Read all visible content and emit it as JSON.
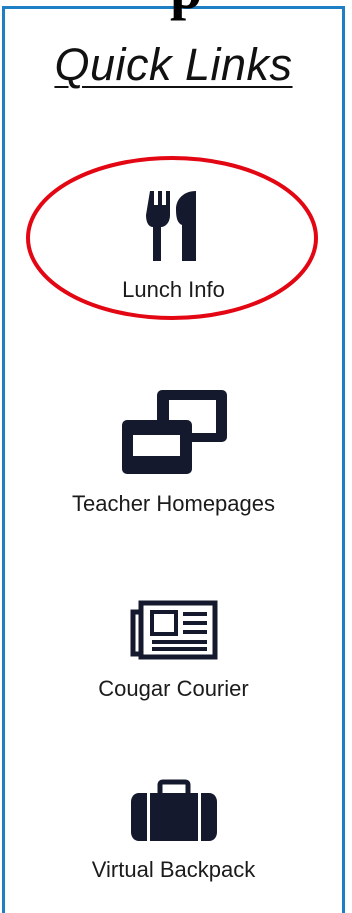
{
  "top_fragment": "p",
  "quick_links": {
    "title": "Quick Links",
    "items": [
      {
        "label": "Lunch Info",
        "icon": "utensils-icon"
      },
      {
        "label": "Teacher Homepages",
        "icon": "windows-icon"
      },
      {
        "label": "Cougar Courier",
        "icon": "newspaper-icon"
      },
      {
        "label": "Virtual Backpack",
        "icon": "briefcase-icon"
      }
    ]
  },
  "colors": {
    "panel_border": "#1f7fc4",
    "icon": "#14192e",
    "highlight": "#e30613"
  }
}
